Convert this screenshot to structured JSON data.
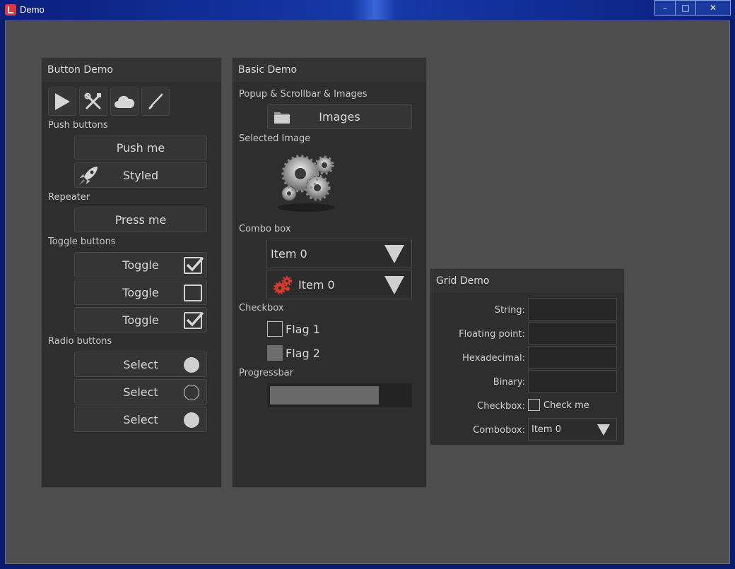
{
  "window": {
    "title": "Demo",
    "minimize": "–",
    "maximize": "□",
    "close": "✕"
  },
  "button_demo": {
    "title": "Button Demo",
    "icons": [
      "play-icon",
      "tools-icon",
      "cloud-icon",
      "brush-icon"
    ],
    "push_label": "Push buttons",
    "push_me": "Push me",
    "styled": "Styled",
    "repeater_label": "Repeater",
    "press_me": "Press me",
    "toggle_label": "Toggle buttons",
    "toggles": [
      {
        "label": "Toggle",
        "checked": true
      },
      {
        "label": "Toggle",
        "checked": false
      },
      {
        "label": "Toggle",
        "checked": true
      }
    ],
    "radio_label": "Radio buttons",
    "radios": [
      {
        "label": "Select",
        "selected": true
      },
      {
        "label": "Select",
        "selected": false
      },
      {
        "label": "Select",
        "selected": true
      }
    ]
  },
  "basic_demo": {
    "title": "Basic Demo",
    "popup_label": "Popup & Scrollbar & Images",
    "images_button": "Images",
    "selected_image_label": "Selected Image",
    "combo_label": "Combo box",
    "combo1_value": "Item 0",
    "combo2_value": "Item 0",
    "checkbox_label": "Checkbox",
    "flag1": "Flag 1",
    "flag1_checked": false,
    "flag2": "Flag 2",
    "flag2_checked": true,
    "progress_label": "Progressbar",
    "progress_value": 0.78
  },
  "grid_demo": {
    "title": "Grid Demo",
    "string_label": "String:",
    "float_label": "Floating point:",
    "hex_label": "Hexadecimal:",
    "binary_label": "Binary:",
    "checkbox_label": "Checkbox:",
    "check_me": "Check me",
    "combobox_label": "Combobox:",
    "combo_value": "Item 0"
  },
  "colors": {
    "panel_bg": "#2e2e2e",
    "client_bg": "#4d4d4d",
    "accent_red": "#d93a2a"
  }
}
